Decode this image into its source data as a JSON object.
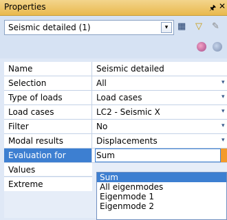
{
  "panel": {
    "title": "Properties",
    "pin_icon": "pin-icon",
    "close_icon": "close-icon"
  },
  "toolbar": {
    "combo_value": "Seismic detailed (1)"
  },
  "rows": [
    {
      "name": "Name",
      "value": "Seismic detailed"
    },
    {
      "name": "Selection",
      "value": "All"
    },
    {
      "name": "Type of loads",
      "value": "Load cases"
    },
    {
      "name": "Load cases",
      "value": "LC2 - Seismic X"
    },
    {
      "name": "Filter",
      "value": "No"
    },
    {
      "name": "Modal results",
      "value": "Displacements"
    },
    {
      "name": "Evaluation for",
      "value": "Sum"
    },
    {
      "name": "Values",
      "value": ""
    },
    {
      "name": "Extreme",
      "value": ""
    }
  ],
  "dropdown": {
    "options": [
      "Sum",
      "All eigenmodes",
      "Eigenmode 1",
      "Eigenmode 2"
    ],
    "selected": "Sum"
  },
  "colors": {
    "title_bar": "#e9b94e",
    "selection": "#3d7fd1",
    "accent": "#f39a2b"
  }
}
